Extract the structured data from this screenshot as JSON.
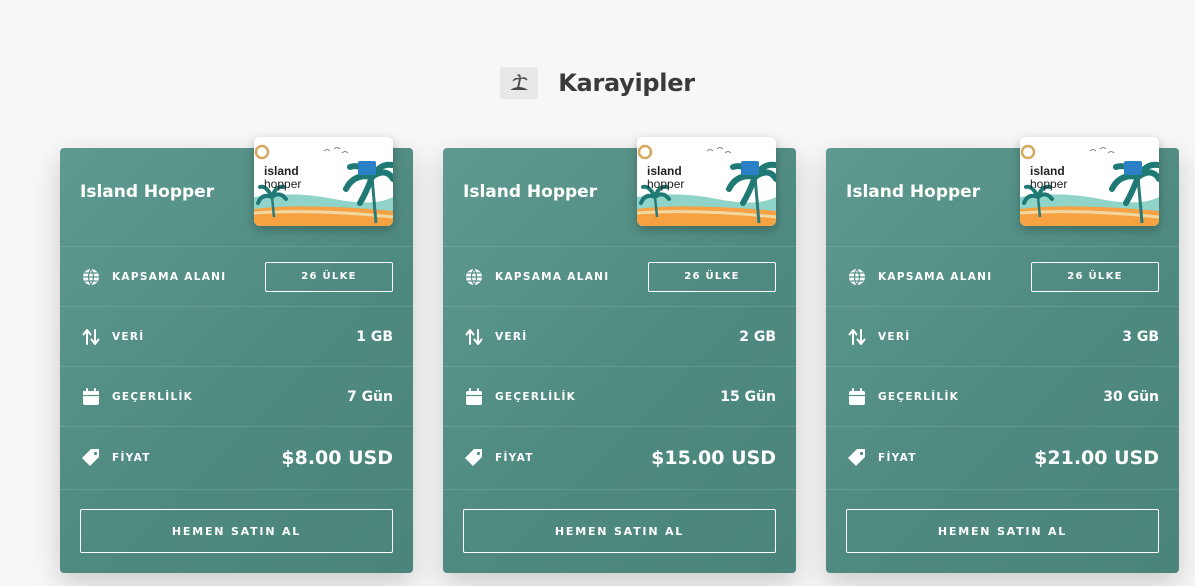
{
  "region": {
    "title": "Karayipler",
    "icon": "island-palm-icon"
  },
  "colors": {
    "card": "#57928a",
    "background": "#f7f7f7",
    "text": "#ffffff"
  },
  "labels": {
    "coverage": "KAPSAMA ALANI",
    "data": "VERİ",
    "validity": "GEÇERLİLİK",
    "price": "FİYAT",
    "buy": "HEMEN SATIN AL"
  },
  "sim_card": {
    "brand_line1": "island",
    "brand_line2": "hopper"
  },
  "cards": [
    {
      "title": "Island Hopper",
      "coverage": "26 ÜLKE",
      "data": "1 GB",
      "validity": "7 Gün",
      "price": "$8.00 USD"
    },
    {
      "title": "Island Hopper",
      "coverage": "26 ÜLKE",
      "data": "2 GB",
      "validity": "15 Gün",
      "price": "$15.00 USD"
    },
    {
      "title": "Island Hopper",
      "coverage": "26 ÜLKE",
      "data": "3 GB",
      "validity": "30 Gün",
      "price": "$21.00 USD"
    }
  ]
}
